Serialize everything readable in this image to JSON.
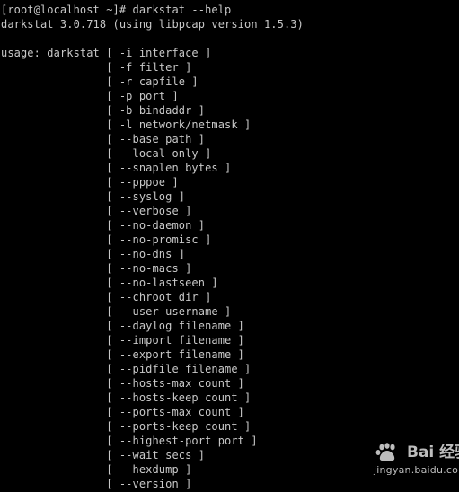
{
  "terminal": {
    "lines": [
      "[root@localhost ~]# darkstat --help",
      "darkstat 3.0.718 (using libpcap version 1.5.3)",
      "",
      "usage: darkstat [ -i interface ]",
      "                [ -f filter ]",
      "                [ -r capfile ]",
      "                [ -p port ]",
      "                [ -b bindaddr ]",
      "                [ -l network/netmask ]",
      "                [ --base path ]",
      "                [ --local-only ]",
      "                [ --snaplen bytes ]",
      "                [ --pppoe ]",
      "                [ --syslog ]",
      "                [ --verbose ]",
      "                [ --no-daemon ]",
      "                [ --no-promisc ]",
      "                [ --no-dns ]",
      "                [ --no-macs ]",
      "                [ --no-lastseen ]",
      "                [ --chroot dir ]",
      "                [ --user username ]",
      "                [ --daylog filename ]",
      "                [ --import filename ]",
      "                [ --export filename ]",
      "                [ --pidfile filename ]",
      "                [ --hosts-max count ]",
      "                [ --hosts-keep count ]",
      "                [ --ports-max count ]",
      "                [ --ports-keep count ]",
      "                [ --highest-port port ]",
      "                [ --wait secs ]",
      "                [ --hexdump ]",
      "                [ --version ]"
    ],
    "text_color": "#c8c8c8",
    "background_color": "#000000"
  },
  "watermark": {
    "brand": "Bai 经验",
    "url": "jingyan.baidu.com",
    "logo_icon": "paw-icon",
    "color": "#bdbdbd"
  }
}
